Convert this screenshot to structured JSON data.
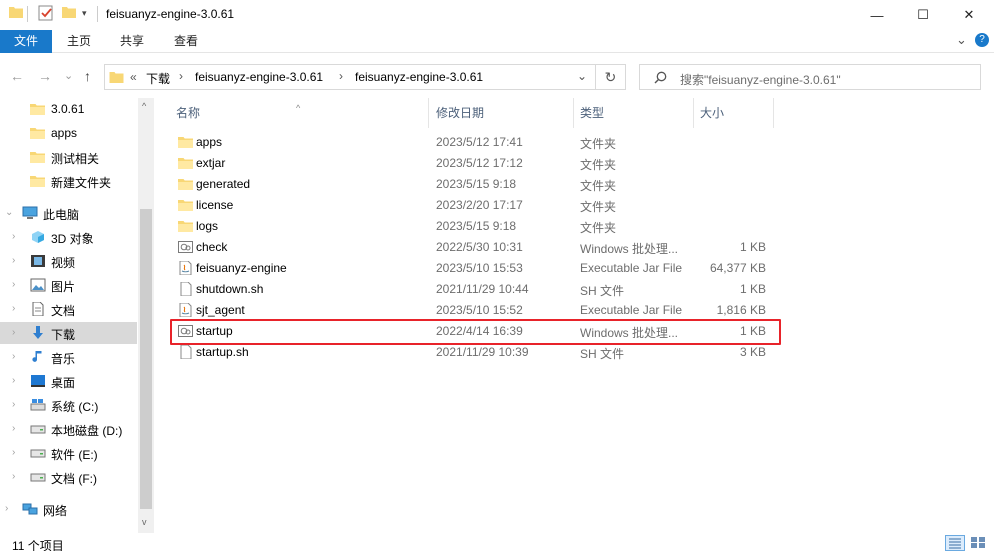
{
  "window": {
    "title": "feisuanyz-engine-3.0.61",
    "minimize_glyph": "—",
    "maximize_glyph": "☐",
    "close_glyph": "✕"
  },
  "ribbon": {
    "file_tab": "文件",
    "tabs": [
      "主页",
      "共享",
      "查看"
    ],
    "expand_glyph": "⌄",
    "help_glyph": "?"
  },
  "address": {
    "overflow": "«",
    "crumbs": [
      "下载",
      "feisuanyz-engine-3.0.61",
      "feisuanyz-engine-3.0.61"
    ],
    "separator": "›",
    "dropdown_glyph": "⌄",
    "refresh_glyph": "↻"
  },
  "search": {
    "placeholder": "搜索\"feisuanyz-engine-3.0.61\""
  },
  "nav": {
    "back": "←",
    "forward": "→",
    "recent": "⌄",
    "up": "↑"
  },
  "tree": [
    {
      "label": "3.0.61",
      "icon": "folder-icon"
    },
    {
      "label": "apps",
      "icon": "folder-icon"
    },
    {
      "label": "测试相关",
      "icon": "folder-icon"
    },
    {
      "label": "新建文件夹",
      "icon": "folder-icon"
    },
    {
      "label": "此电脑",
      "icon": "computer-icon"
    },
    {
      "label": "3D 对象",
      "icon": "3d-objects-icon"
    },
    {
      "label": "视频",
      "icon": "video-icon"
    },
    {
      "label": "图片",
      "icon": "pictures-icon"
    },
    {
      "label": "文档",
      "icon": "documents-icon"
    },
    {
      "label": "下载",
      "icon": "download-icon"
    },
    {
      "label": "音乐",
      "icon": "music-icon"
    },
    {
      "label": "桌面",
      "icon": "desktop-icon"
    },
    {
      "label": "系统 (C:)",
      "icon": "drive-c-icon"
    },
    {
      "label": "本地磁盘 (D:)",
      "icon": "drive-icon"
    },
    {
      "label": "软件 (E:)",
      "icon": "drive-icon"
    },
    {
      "label": "文档 (F:)",
      "icon": "drive-icon"
    },
    {
      "label": "网络",
      "icon": "network-icon"
    }
  ],
  "columns": {
    "name": "名称",
    "date": "修改日期",
    "type": "类型",
    "size": "大小",
    "sort_glyph": "^"
  },
  "files": [
    {
      "name": "apps",
      "date": "2023/5/12 17:41",
      "type": "文件夹",
      "size": "",
      "icon": "folder-icon"
    },
    {
      "name": "extjar",
      "date": "2023/5/12 17:12",
      "type": "文件夹",
      "size": "",
      "icon": "folder-icon"
    },
    {
      "name": "generated",
      "date": "2023/5/15 9:18",
      "type": "文件夹",
      "size": "",
      "icon": "folder-icon"
    },
    {
      "name": "license",
      "date": "2023/2/20 17:17",
      "type": "文件夹",
      "size": "",
      "icon": "folder-icon"
    },
    {
      "name": "logs",
      "date": "2023/5/15 9:18",
      "type": "文件夹",
      "size": "",
      "icon": "folder-icon"
    },
    {
      "name": "check",
      "date": "2022/5/30 10:31",
      "type": "Windows 批处理...",
      "size": "1 KB",
      "icon": "batch-file-icon"
    },
    {
      "name": "feisuanyz-engine",
      "date": "2023/5/10 15:53",
      "type": "Executable Jar File",
      "size": "64,377 KB",
      "icon": "jar-file-icon"
    },
    {
      "name": "shutdown.sh",
      "date": "2021/11/29 10:44",
      "type": "SH 文件",
      "size": "1 KB",
      "icon": "file-icon"
    },
    {
      "name": "sjt_agent",
      "date": "2023/5/10 15:52",
      "type": "Executable Jar File",
      "size": "1,816 KB",
      "icon": "jar-file-icon"
    },
    {
      "name": "startup",
      "date": "2022/4/14 16:39",
      "type": "Windows 批处理...",
      "size": "1 KB",
      "icon": "batch-file-icon"
    },
    {
      "name": "startup.sh",
      "date": "2021/11/29 10:39",
      "type": "SH 文件",
      "size": "3 KB",
      "icon": "file-icon"
    }
  ],
  "status": {
    "count": "11 个项目"
  },
  "colors": {
    "file_tab": "#1979ca",
    "folder": "#f8d775",
    "highlight": "#e8232a",
    "selected": "#d9d9d9"
  }
}
